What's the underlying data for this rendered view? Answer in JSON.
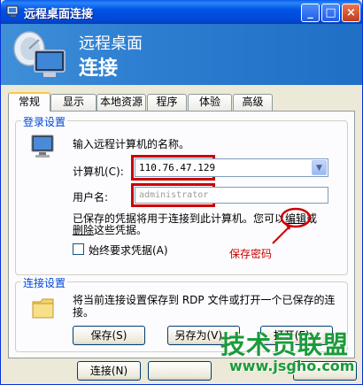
{
  "window": {
    "title": "远程桌面连接",
    "minimize_glyph": "_",
    "maximize_glyph": "□",
    "close_glyph": "×"
  },
  "banner": {
    "line1": "远程桌面",
    "line2": "连接"
  },
  "tabs": [
    {
      "label": "常规",
      "active": true
    },
    {
      "label": "显示"
    },
    {
      "label": "本地资源"
    },
    {
      "label": "程序"
    },
    {
      "label": "体验"
    },
    {
      "label": "高级"
    }
  ],
  "login": {
    "group_label": "登录设置",
    "instruction": "输入远程计算机的名称。",
    "computer_label": "计算机(C):",
    "computer_value": "110.76.47.129",
    "username_label": "用户名:",
    "username_value": "administrator",
    "saved_text_a": "已保存的凭据将用于连接到此计算机。您可以",
    "edit_link": "编辑",
    "saved_text_b": "或",
    "delete_link": "删除",
    "saved_text_c": "这些凭据。",
    "always_ask_label": "始终要求凭据(A)",
    "annotation": "保存密码"
  },
  "connection": {
    "group_label": "连接设置",
    "description": "将当前连接设置保存到 RDP 文件或打开一个已保存的连接。",
    "save_button": "保存(S)",
    "save_as_button": "另存为(V)...",
    "open_button": "打开(E)..."
  },
  "footer": {
    "connect_button": "连接(N)"
  },
  "watermark": {
    "line1": "技术员联盟",
    "line2": "www.jsgho.com"
  }
}
